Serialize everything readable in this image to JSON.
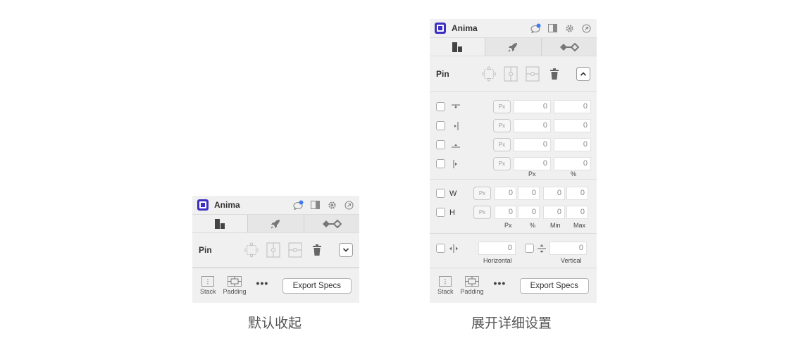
{
  "app": {
    "name": "Anima"
  },
  "tabs": [
    {
      "name": "layout",
      "icon": "layout-icon",
      "active": true
    },
    {
      "name": "launch",
      "icon": "rocket-icon",
      "active": false
    },
    {
      "name": "link",
      "icon": "link-icon",
      "active": false
    }
  ],
  "pin": {
    "label": "Pin"
  },
  "offsets": {
    "rows": [
      {
        "icon": "pin-top-icon",
        "unit": "Px",
        "value_px": "0",
        "value_pct": "0"
      },
      {
        "icon": "pin-left-icon",
        "unit": "Px",
        "value_px": "0",
        "value_pct": "0"
      },
      {
        "icon": "pin-bottom-icon",
        "unit": "Px",
        "value_px": "0",
        "value_pct": "0"
      },
      {
        "icon": "pin-right-icon",
        "unit": "Px",
        "value_px": "0",
        "value_pct": "0"
      }
    ],
    "col_px": "Px",
    "col_pct": "%"
  },
  "size": {
    "rows": [
      {
        "label": "W",
        "unit": "Px",
        "px": "0",
        "pct": "0",
        "min": "0",
        "max": "0"
      },
      {
        "label": "H",
        "unit": "Px",
        "px": "0",
        "pct": "0",
        "min": "0",
        "max": "0"
      }
    ],
    "col_px": "Px",
    "col_pct": "%",
    "col_min": "Min",
    "col_max": "Max"
  },
  "spacing": {
    "horizontal_value": "0",
    "vertical_value": "0",
    "horizontal_label": "Horizontal",
    "vertical_label": "Vertical"
  },
  "footer": {
    "stack_label": "Stack",
    "padding_label": "Padding",
    "more_label": "•••",
    "export_label": "Export Specs"
  },
  "captions": {
    "collapsed": "默认收起",
    "expanded": "展开详细设置"
  },
  "colors": {
    "brand": "#3d2fc2",
    "badge": "#3d7bf5"
  }
}
